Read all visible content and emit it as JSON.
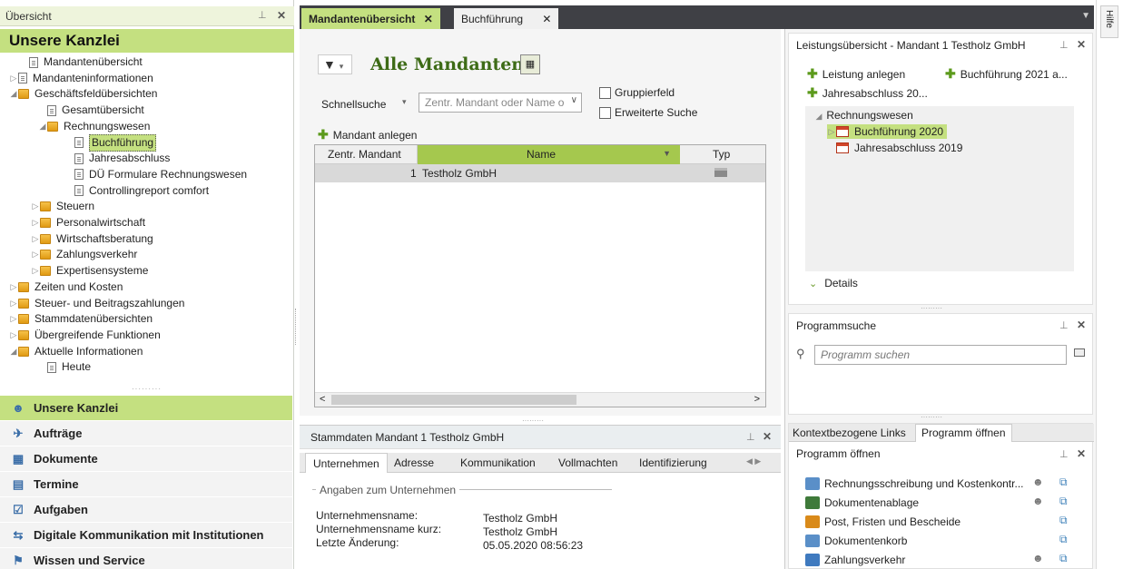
{
  "left_panel": {
    "title": "Übersicht",
    "heading": "Unsere Kanzlei",
    "tree": [
      {
        "label": "Mandantenübersicht",
        "icon": "doc-icon",
        "tri": ""
      },
      {
        "label": "Mandanteninformationen",
        "icon": "doc-icon",
        "tri": "▷"
      },
      {
        "label": "Geschäftsfeldübersichten",
        "icon": "folder-icon",
        "tri": "◢"
      },
      {
        "label": "Gesamtübersicht",
        "icon": "doc-icon",
        "tri": ""
      },
      {
        "label": "Rechnungswesen",
        "icon": "folder-icon",
        "tri": "◢"
      },
      {
        "label": "Buchführung",
        "icon": "doc-icon",
        "tri": "",
        "selected": true
      },
      {
        "label": "Jahresabschluss",
        "icon": "doc-icon",
        "tri": ""
      },
      {
        "label": "DÜ Formulare Rechnungswesen",
        "icon": "doc-icon",
        "tri": ""
      },
      {
        "label": "Controllingreport comfort",
        "icon": "doc-icon",
        "tri": ""
      },
      {
        "label": "Steuern",
        "icon": "folder-icon",
        "tri": "▷"
      },
      {
        "label": "Personalwirtschaft",
        "icon": "folder-icon",
        "tri": "▷"
      },
      {
        "label": "Wirtschaftsberatung",
        "icon": "folder-icon",
        "tri": "▷"
      },
      {
        "label": "Zahlungsverkehr",
        "icon": "folder-icon",
        "tri": "▷"
      },
      {
        "label": "Expertisensysteme",
        "icon": "folder-icon",
        "tri": "▷"
      },
      {
        "label": "Zeiten und Kosten",
        "icon": "folder-icon",
        "tri": "▷"
      },
      {
        "label": "Steuer- und Beitragszahlungen",
        "icon": "folder-icon",
        "tri": "▷"
      },
      {
        "label": "Stammdatenübersichten",
        "icon": "folder-icon",
        "tri": "▷"
      },
      {
        "label": "Übergreifende Funktionen",
        "icon": "folder-icon",
        "tri": "▷"
      },
      {
        "label": "Aktuelle Informationen",
        "icon": "folder-icon",
        "tri": "◢"
      },
      {
        "label": "Heute",
        "icon": "doc-icon",
        "tri": ""
      }
    ],
    "nav": [
      {
        "label": "Unsere Kanzlei",
        "icon": "people-icon",
        "active": true
      },
      {
        "label": "Aufträge",
        "icon": "orders-icon"
      },
      {
        "label": "Dokumente",
        "icon": "grid-icon"
      },
      {
        "label": "Termine",
        "icon": "calendar-icon"
      },
      {
        "label": "Aufgaben",
        "icon": "checkbox-icon"
      },
      {
        "label": "Digitale Kommunikation mit Institutionen",
        "icon": "arrows-icon"
      },
      {
        "label": "Wissen und Service",
        "icon": "signpost-icon"
      }
    ]
  },
  "tabs": [
    {
      "label": "Mandantenübersicht",
      "active": true
    },
    {
      "label": "Buchführung",
      "active": false
    }
  ],
  "main": {
    "heading": "Alle Mandanten",
    "schnellsuche_label": "Schnellsuche",
    "search_placeholder": "Zentr. Mandant oder Name o",
    "check_gruppierfeld": "Gruppierfeld",
    "check_erweiterte": "Erweiterte Suche",
    "add_label": "Mandant anlegen",
    "columns": [
      "Zentr. Mandant",
      "Name",
      "Typ"
    ],
    "rows": [
      {
        "nr": "1",
        "name": "Testholz GmbH"
      }
    ]
  },
  "stammdaten": {
    "title": "Stammdaten Mandant 1 Testholz GmbH",
    "tabs": [
      "Unternehmen",
      "Adresse",
      "Kommunikation",
      "Vollmachten",
      "Identifizierung"
    ],
    "group_label": "Angaben zum Unternehmen",
    "fields": [
      {
        "label": "Unternehmensname:",
        "value": "Testholz GmbH"
      },
      {
        "label": "Unternehmensname kurz:",
        "value": "Testholz GmbH"
      },
      {
        "label": "Letzte Änderung:",
        "value": "05.05.2020 08:56:23"
      }
    ]
  },
  "leistung": {
    "title": "Leistungsübersicht - Mandant 1 Testholz GmbH",
    "actions": [
      "Leistung anlegen",
      "Buchführung 2021 a...",
      "Jahresabschluss 20..."
    ],
    "tree_root": "Rechnungswesen",
    "items": [
      "Buchführung 2020",
      "Jahresabschluss 2019"
    ],
    "details": "Details"
  },
  "programmsuche": {
    "title": "Programmsuche",
    "placeholder": "Programm suchen"
  },
  "programm": {
    "tabs": [
      "Kontextbezogene Links",
      "Programm öffnen"
    ],
    "title": "Programm öffnen",
    "items": [
      "Rechnungsschreibung und Kostenkontr...",
      "Dokumentenablage",
      "Post, Fristen und Bescheide",
      "Dokumentenkorb",
      "Zahlungsverkehr"
    ]
  },
  "hilfe": "Hilfe",
  "colors": {
    "accent": "#c4e080",
    "tabbar": "#3f4045",
    "heading": "#3d6b16"
  }
}
